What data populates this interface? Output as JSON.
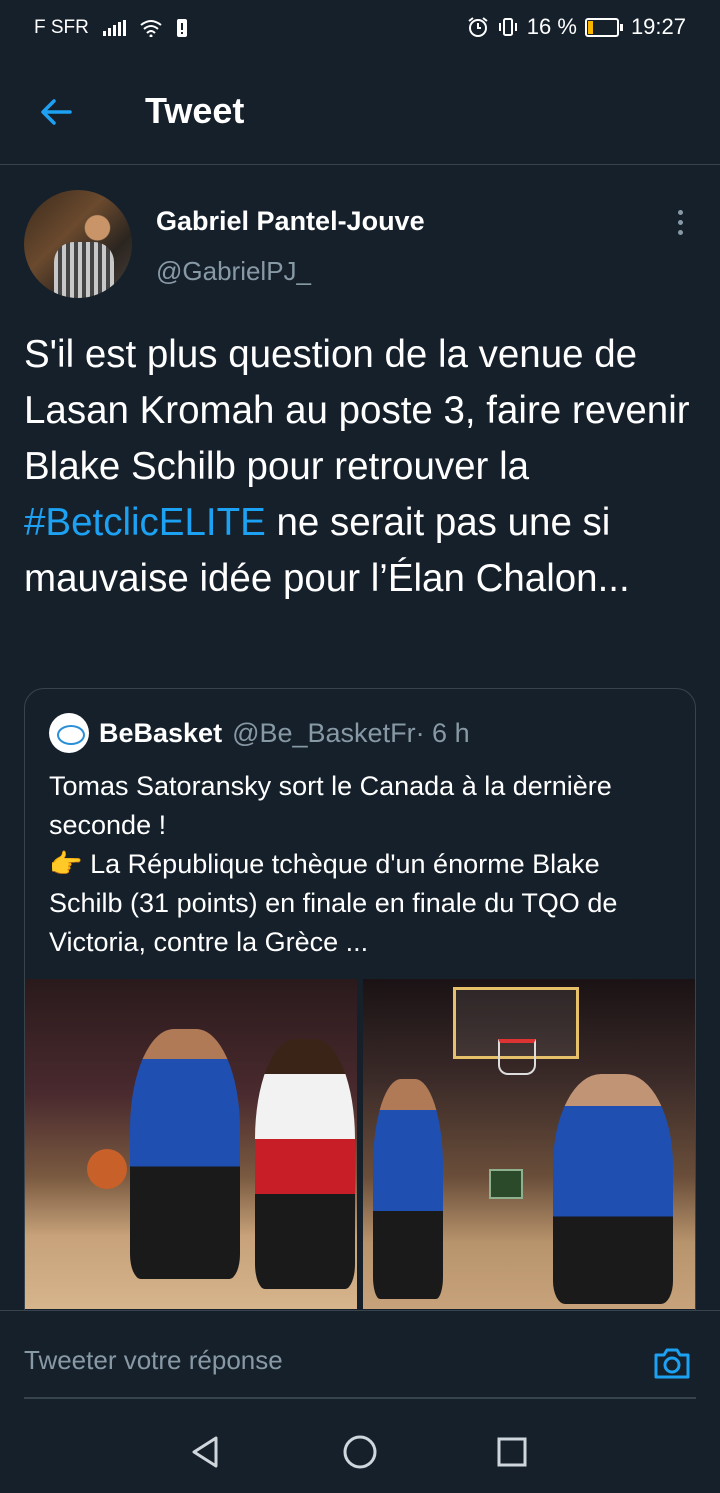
{
  "status_bar": {
    "carrier": "F SFR",
    "battery_percent": "16 %",
    "battery_level": 0.16,
    "time": "19:27",
    "icons": [
      "signal-icon",
      "wifi-icon",
      "sim-icon",
      "alarm-icon",
      "vibrate-icon",
      "battery-icon"
    ]
  },
  "header": {
    "title": "Tweet",
    "back_icon": "arrow-left-icon"
  },
  "tweet": {
    "author_name": "Gabriel Pantel-Jouve",
    "author_handle": "@GabrielPJ_",
    "text_before": "S'il est plus question de la venue de Lasan Kromah au poste 3, faire revenir Blake Schilb pour retrouver la ",
    "hashtag": "#BetclicELITE",
    "text_after": " ne serait pas une si mauvaise idée pour l’Élan Chalon...",
    "more_icon": "more-vertical-icon"
  },
  "quoted_tweet": {
    "name": "BeBasket",
    "handle": "@Be_BasketFr",
    "time": " · 6 h",
    "line1": "Tomas Satoransky sort le Canada à la dernière seconde !",
    "emoji": "👉",
    "line2": " La République tchèque d'un énorme Blake Schilb (31 points) en finale en finale du TQO de Victoria, contre la Grèce ..."
  },
  "reply_bar": {
    "placeholder": "Tweeter votre réponse",
    "camera_icon": "camera-icon"
  },
  "nav_bar": {
    "icons": [
      "back-triangle-icon",
      "home-circle-icon",
      "recents-square-icon"
    ]
  },
  "colors": {
    "background": "#15202b",
    "accent": "#1da1f2",
    "secondary_text": "#8899a6",
    "divider": "#38444d"
  }
}
